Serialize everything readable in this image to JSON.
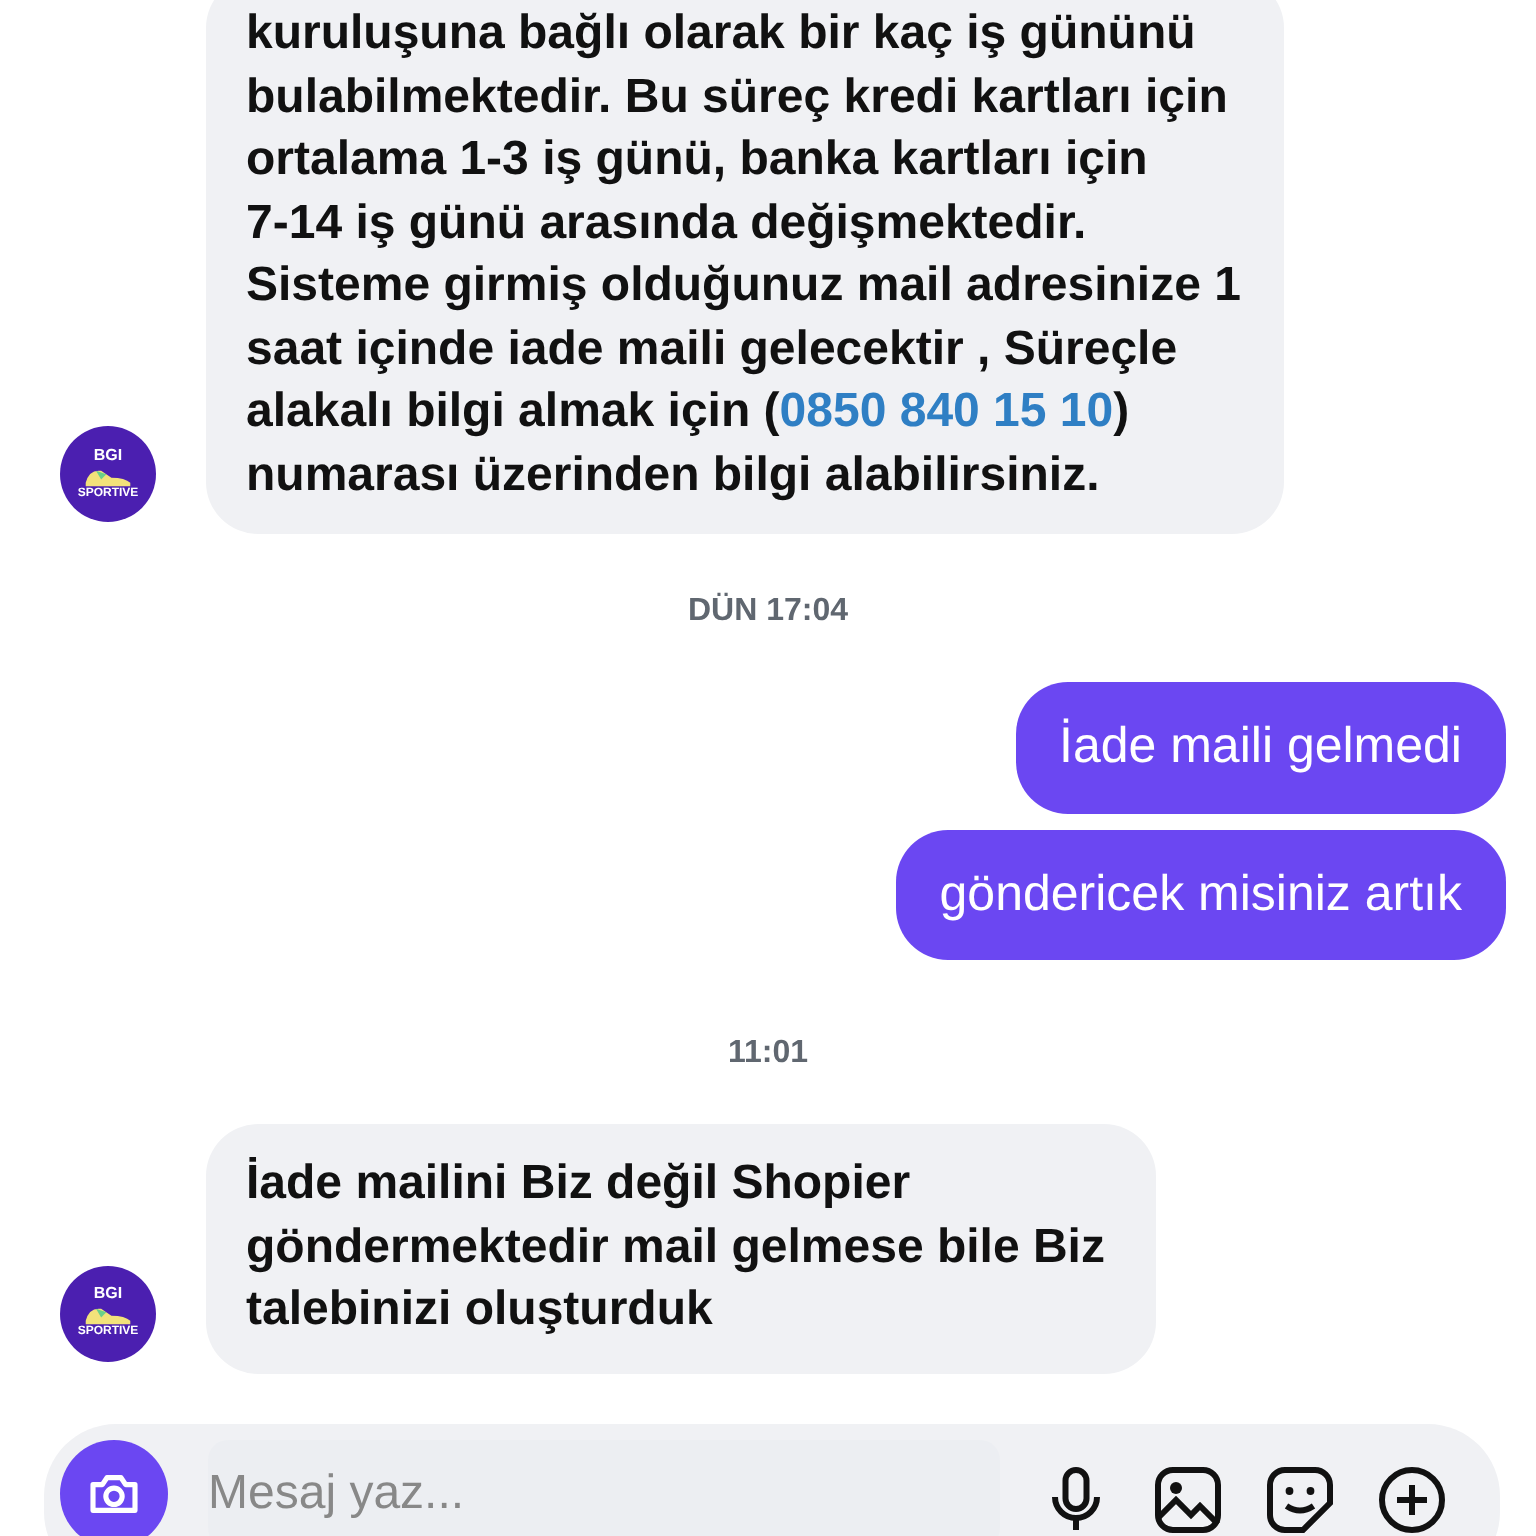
{
  "messages": [
    {
      "kind": "incoming",
      "avatar": {
        "line_1": "BGI",
        "line_2": "SPORTIVE"
      },
      "parts": [
        {
          "kind": "text",
          "text": "kuruluşuna bağlı olarak bir kaç iş gününü\nbulabilmektedir. Bu süreç kredi kartları için\nortalama 1-3 iş günü, banka kartları için\n7-14 iş günü arasında değişmektedir.\nSisteme girmiş olduğunuz mail adresinize 1\nsaat içinde iade maili gelecektir , Süreçle\nalakalı bilgi almak için ("
        },
        {
          "kind": "link",
          "text": "0850 840 15 10"
        },
        {
          "kind": "text",
          "text": ")\nnumarası üzerinden bilgi alabilirsiniz."
        }
      ]
    },
    {
      "kind": "time",
      "text": "DÜN 17:04"
    },
    {
      "kind": "outgoing",
      "parts": [
        {
          "kind": "text",
          "text": "İade maili gelmedi"
        }
      ]
    },
    {
      "kind": "outgoing",
      "parts": [
        {
          "kind": "text",
          "text": "göndericek misiniz artık"
        }
      ]
    },
    {
      "kind": "time",
      "text": "11:01"
    },
    {
      "kind": "incoming",
      "avatar": {
        "line_1": "BGI",
        "line_2": "SPORTIVE"
      },
      "parts": [
        {
          "kind": "text",
          "text": "İade mailini Biz değil Shopier\ngöndermektedir mail gelmese bile Biz\ntalebinizi oluşturduk"
        }
      ]
    }
  ],
  "composer": {
    "placeholder": "Mesaj yaz..."
  }
}
